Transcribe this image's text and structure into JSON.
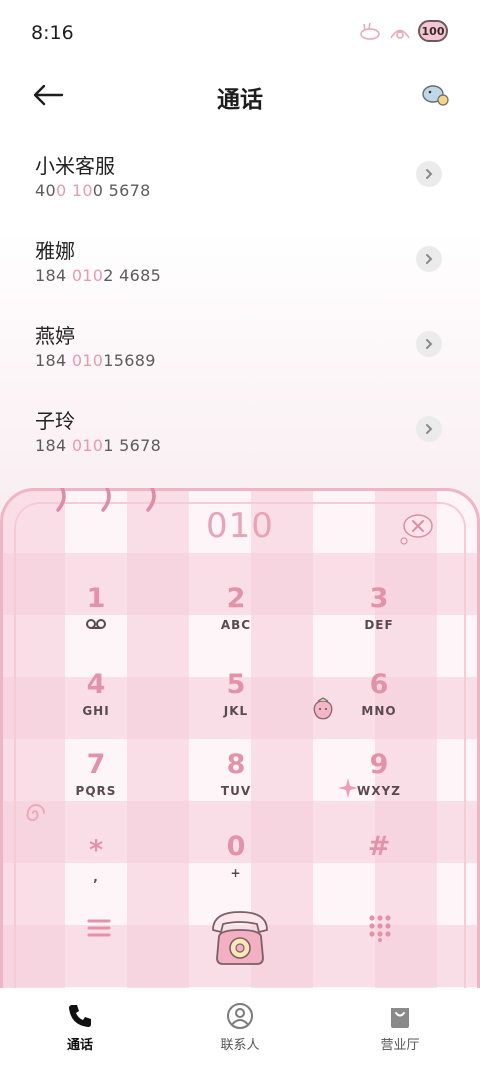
{
  "status": {
    "time": "8:16",
    "battery": "100"
  },
  "header": {
    "title": "通话"
  },
  "calls": [
    {
      "name": "小米客服",
      "number_parts": [
        "40",
        "0 10",
        "0 5678"
      ]
    },
    {
      "name": "雅娜",
      "number_parts": [
        "184 ",
        "010",
        "2 4685"
      ]
    },
    {
      "name": "燕婷",
      "number_parts": [
        "184 ",
        "010",
        "15689"
      ]
    },
    {
      "name": "子玲",
      "number_parts": [
        "184 ",
        "010",
        "1 5678"
      ]
    }
  ],
  "dialer": {
    "dialed": "010",
    "keys": [
      {
        "digit": "1",
        "letters": ""
      },
      {
        "digit": "2",
        "letters": "ABC"
      },
      {
        "digit": "3",
        "letters": "DEF"
      },
      {
        "digit": "4",
        "letters": "GHI"
      },
      {
        "digit": "5",
        "letters": "JKL"
      },
      {
        "digit": "6",
        "letters": "MNO"
      },
      {
        "digit": "7",
        "letters": "PQRS"
      },
      {
        "digit": "8",
        "letters": "TUV"
      },
      {
        "digit": "9",
        "letters": "WXYZ"
      },
      {
        "digit": "*",
        "letters": ","
      },
      {
        "digit": "0",
        "letters": "+"
      },
      {
        "digit": "#",
        "letters": ""
      }
    ]
  },
  "nav": [
    {
      "label": "通话",
      "icon": "phone-icon",
      "active": true
    },
    {
      "label": "联系人",
      "icon": "contacts-icon",
      "active": false
    },
    {
      "label": "营业厅",
      "icon": "shopping-bag-icon",
      "active": false
    }
  ],
  "colors": {
    "accent": "#e392ab",
    "highlight": "#e79ab0",
    "card_border": "#f0b5c5"
  }
}
